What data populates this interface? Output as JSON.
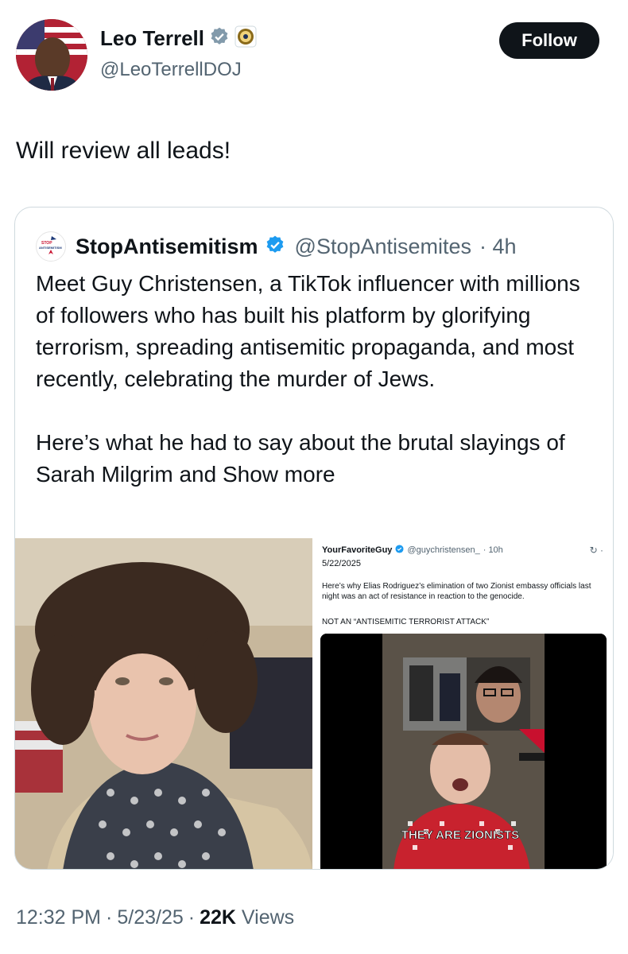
{
  "author": {
    "name": "Leo Terrell",
    "handle": "@LeoTerrellDOJ",
    "follow_label": "Follow",
    "verified_color": "#829aab"
  },
  "tweet": {
    "text": "Will review all leads!"
  },
  "quoted": {
    "name": "StopAntisemitism",
    "handle": "@StopAntisemites",
    "time": "· 4h",
    "paragraph1": "Meet Guy Christensen, a TikTok influencer with millions of followers who has built his platform by glorifying terrorism, spreading antisemitic propaganda, and most recently, celebrating the murder of Jews.",
    "paragraph2": "Here’s what he had to say about the brutal slayings of Sarah Milgrim and ",
    "show_more": "Show more",
    "verified_color": "#1d9bf0",
    "logo_lines": [
      "STOP",
      "ANTISEMITISM"
    ],
    "media": {
      "screenshot": {
        "name": "YourFavoriteGuy",
        "handle": "@guychristensen_",
        "time": "· 10h",
        "date": "5/22/2025",
        "text": "Here’s why Elias Rodriguez’s elimination of two Zionist embassy officials last night was an act of resistance in reaction to the genocide.",
        "caption": "NOT AN “ANTISEMITIC TERRORIST ATTACK”",
        "video_caption": "THEY ARE ZIONISTS"
      }
    }
  },
  "meta": {
    "time": "12:32 PM",
    "date": "5/23/25",
    "views_count": "22K",
    "views_label": "Views"
  }
}
